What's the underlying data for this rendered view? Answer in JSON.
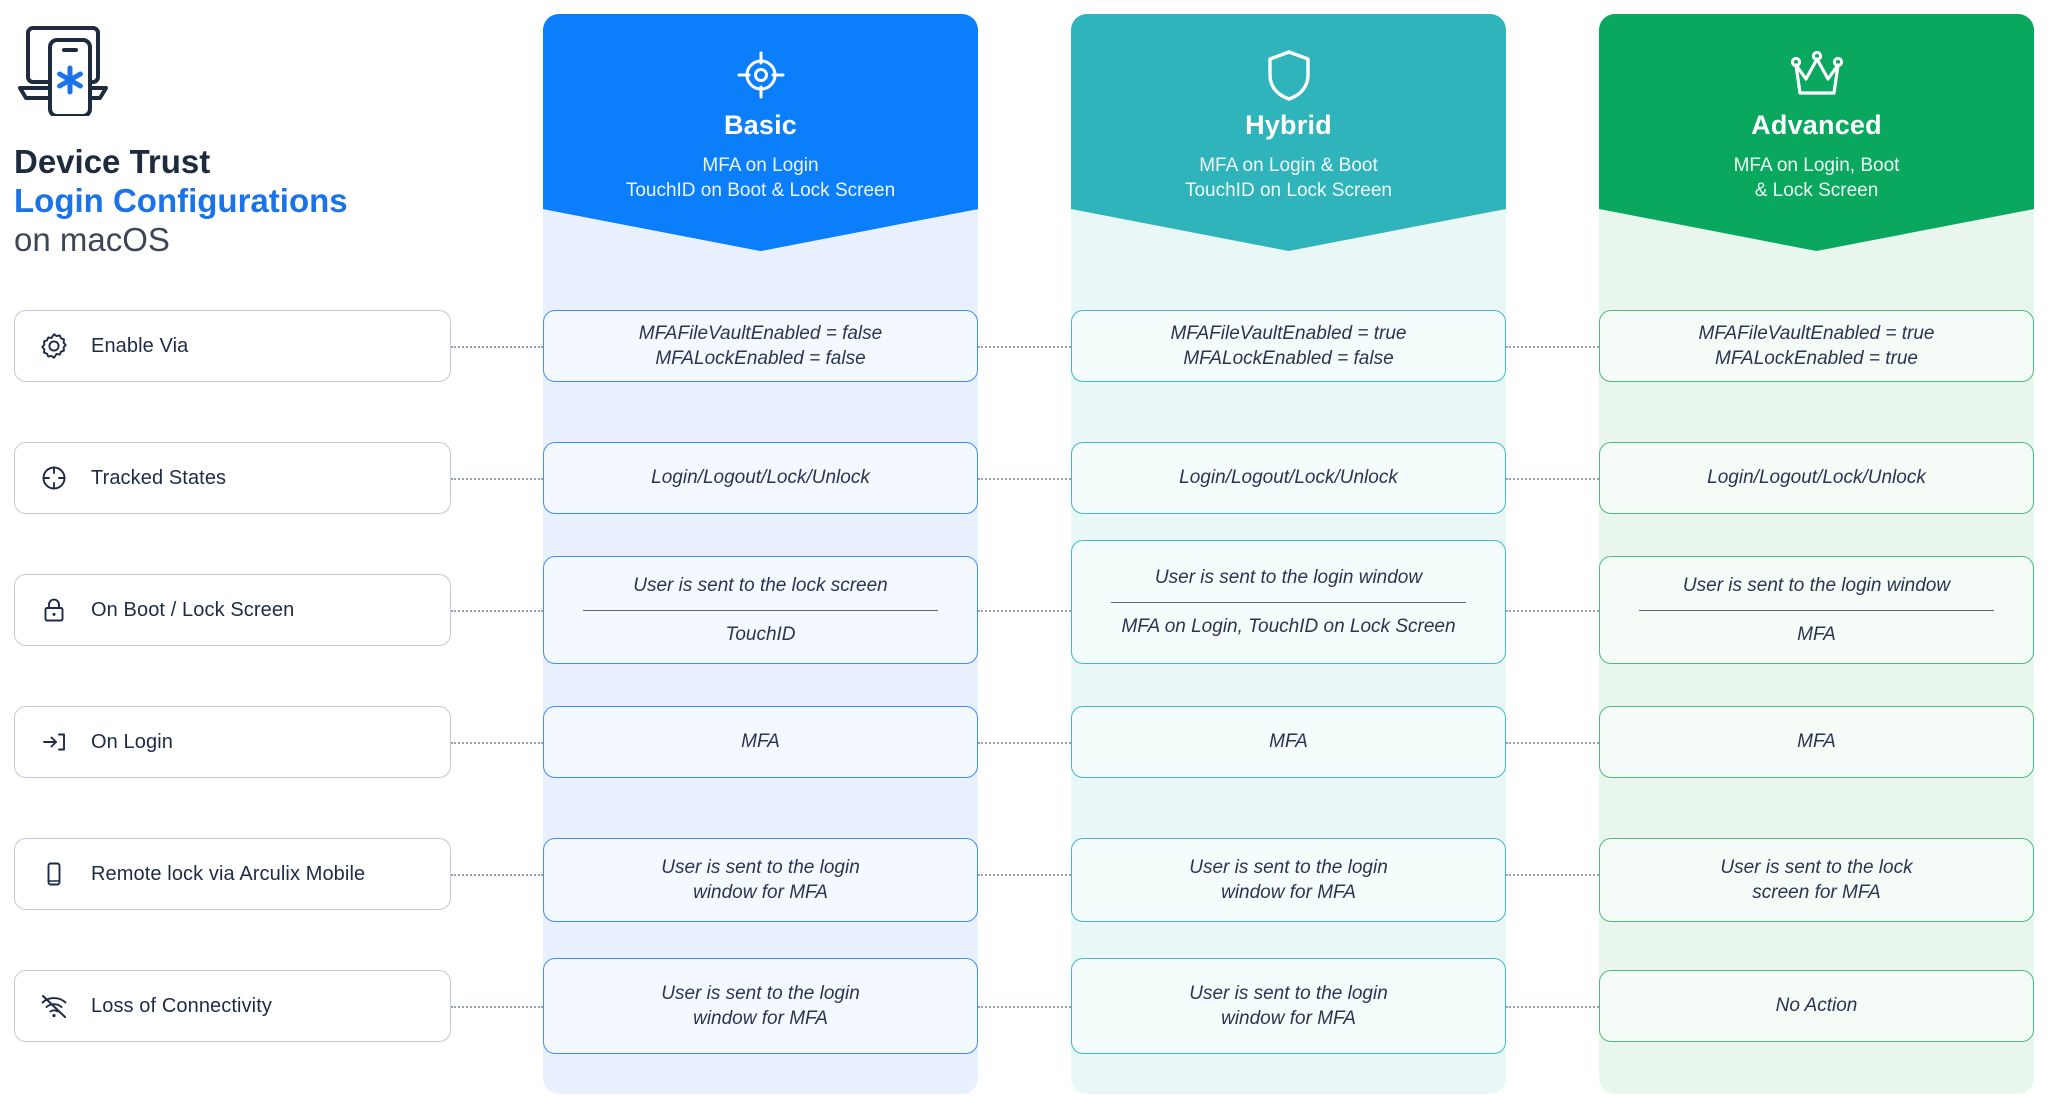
{
  "title": {
    "line1": "Device Trust",
    "line2": "Login Configurations",
    "line3": "on macOS",
    "icon": "laptop-phone-asterisk-icon"
  },
  "colors": {
    "basic": "#0b7efc",
    "hybrid": "#2fb4bc",
    "advanced": "#0aa85f",
    "basic_bg": "#e8f0fd",
    "hybrid_bg": "#e9f7f7",
    "advanced_bg": "#e9f6ee",
    "title_accent": "#1a73e8",
    "title_dark": "#1e2a3e"
  },
  "columns": [
    {
      "key": "basic",
      "icon": "target-crosshair-icon",
      "name": "Basic",
      "subtitle_line1": "MFA on Login",
      "subtitle_line2": "TouchID on Boot & Lock Screen"
    },
    {
      "key": "hybrid",
      "icon": "shield-icon",
      "name": "Hybrid",
      "subtitle_line1": "MFA on Login & Boot",
      "subtitle_line2": "TouchID on Lock Screen"
    },
    {
      "key": "advanced",
      "icon": "crown-icon",
      "name": "Advanced",
      "subtitle_line1": "MFA on Login, Boot",
      "subtitle_line2": "& Lock Screen"
    }
  ],
  "rows": [
    {
      "icon": "gear-icon",
      "label": "Enable Via",
      "cells": {
        "basic": {
          "top": "MFAFileVaultEnabled = false",
          "top2": "MFALockEnabled = false"
        },
        "hybrid": {
          "top": "MFAFileVaultEnabled = true",
          "top2": "MFALockEnabled = false"
        },
        "advanced": {
          "top": "MFAFileVaultEnabled = true",
          "top2": "MFALockEnabled = true"
        }
      }
    },
    {
      "icon": "crosshair-icon",
      "label": "Tracked States",
      "cells": {
        "basic": {
          "top": "Login/Logout/Lock/Unlock"
        },
        "hybrid": {
          "top": "Login/Logout/Lock/Unlock"
        },
        "advanced": {
          "top": "Login/Logout/Lock/Unlock"
        }
      }
    },
    {
      "icon": "lock-icon",
      "label": "On Boot / Lock Screen",
      "cells": {
        "basic": {
          "top": "User is sent to the lock screen",
          "bottom": "TouchID"
        },
        "hybrid": {
          "top": "User is sent to the login window",
          "bottom": "MFA on Login, TouchID on Lock Screen"
        },
        "advanced": {
          "top": "User is sent to the login window",
          "bottom": "MFA"
        }
      }
    },
    {
      "icon": "login-arrow-icon",
      "label": "On Login",
      "cells": {
        "basic": {
          "top": "MFA"
        },
        "hybrid": {
          "top": "MFA"
        },
        "advanced": {
          "top": "MFA"
        }
      }
    },
    {
      "icon": "mobile-phone-icon",
      "label": "Remote lock via Arculix Mobile",
      "cells": {
        "basic": {
          "top": "User is sent to the login",
          "top2": "window for MFA"
        },
        "hybrid": {
          "top": "User is sent to the login",
          "top2": "window for MFA"
        },
        "advanced": {
          "top": "User is sent to the lock",
          "top2": "screen for MFA"
        }
      }
    },
    {
      "icon": "wifi-off-icon",
      "label": "Loss of Connectivity",
      "cells": {
        "basic": {
          "top": "User is sent to the login",
          "top2": "window for MFA"
        },
        "hybrid": {
          "top": "User is sent to the login",
          "top2": "window for MFA"
        },
        "advanced": {
          "top": "No Action"
        }
      }
    }
  ]
}
